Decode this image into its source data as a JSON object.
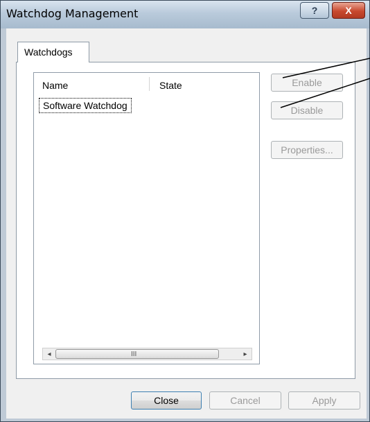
{
  "window": {
    "title": "Watchdog Management"
  },
  "caption_buttons": {
    "help": "?",
    "close": "X"
  },
  "tabs": [
    {
      "label": "Watchdogs"
    }
  ],
  "listview": {
    "columns": [
      "Name",
      "State"
    ],
    "items": [
      {
        "name": "Software Watchdog",
        "state": ""
      }
    ],
    "scrollbar": {
      "left_arrow": "◂",
      "right_arrow": "▸",
      "grip": "III"
    }
  },
  "side_buttons": {
    "enable": "Enable",
    "disable": "Disable",
    "properties": "Properties..."
  },
  "dialog_buttons": {
    "close": "Close",
    "cancel": "Cancel",
    "apply": "Apply"
  }
}
